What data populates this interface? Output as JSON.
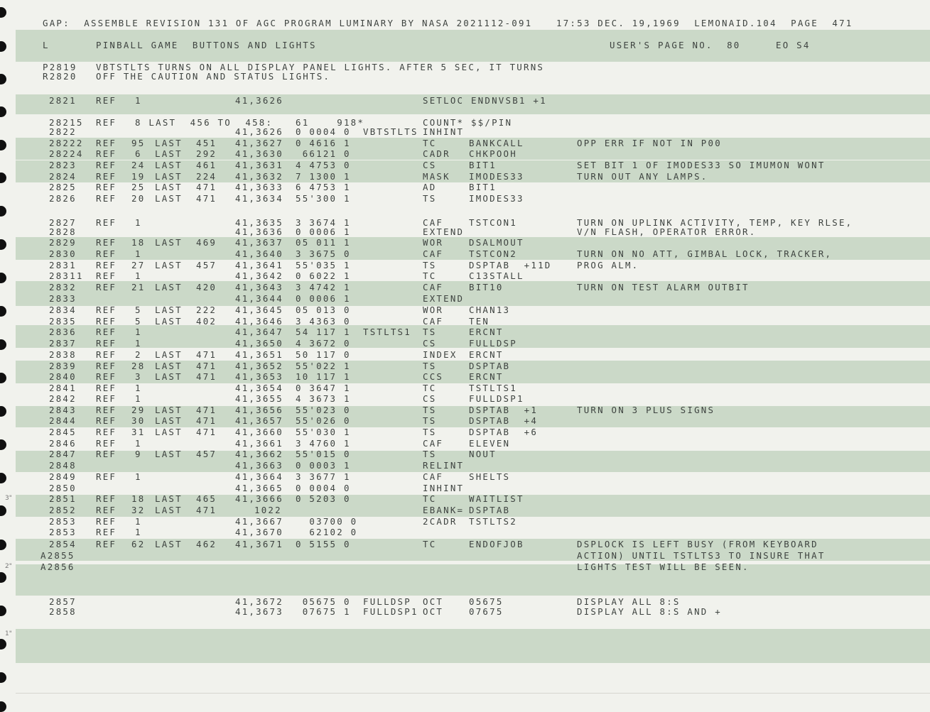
{
  "lines": [
    [
      26,
      60,
      "GAP:  ASSEMBLE REVISION 131 OF AGC PROGRAM LUMINARY BY NASA 2021112-091"
    ],
    [
      26,
      783,
      "17:53 DEC. 19,1969  LEMONAID.104  PAGE  471"
    ],
    [
      57,
      60,
      "L"
    ],
    [
      57,
      135,
      "PINBALL GAME  BUTTONS AND LIGHTS"
    ],
    [
      57,
      858,
      "USER'S PAGE NO.  80"
    ],
    [
      57,
      1092,
      "EO S4"
    ],
    [
      88,
      60,
      "P2819"
    ],
    [
      88,
      135,
      "VBTSTLTS TURNS ON ALL DISPLAY PANEL LIGHTS. AFTER 5 SEC, IT TURNS"
    ],
    [
      101,
      60,
      "R2820"
    ],
    [
      101,
      135,
      "OFF THE CAUTION AND STATUS LIGHTS."
    ],
    [
      135,
      69,
      "2821"
    ],
    [
      135,
      135,
      "REF"
    ],
    [
      135,
      190,
      "1"
    ],
    [
      135,
      331,
      "41,3626"
    ],
    [
      135,
      595,
      "SETLOC ENDNVSB1 +1"
    ],
    [
      166,
      69,
      "28215"
    ],
    [
      166,
      135,
      "REF"
    ],
    [
      166,
      190,
      "8 LAST  456 TO  458:"
    ],
    [
      166,
      416,
      "61    918*"
    ],
    [
      166,
      595,
      "COUNT* $$/PIN"
    ],
    [
      179,
      69,
      "2822"
    ],
    [
      179,
      331,
      "41,3626"
    ],
    [
      179,
      416,
      "0 0004 0"
    ],
    [
      179,
      511,
      "VBTSTLTS"
    ],
    [
      179,
      595,
      "INHINT"
    ],
    [
      195,
      69,
      "28222"
    ],
    [
      195,
      135,
      "REF"
    ],
    [
      195,
      185,
      "95"
    ],
    [
      195,
      218,
      "LAST"
    ],
    [
      195,
      276,
      "451"
    ],
    [
      195,
      331,
      "41,3627"
    ],
    [
      195,
      416,
      "0 4616 1"
    ],
    [
      195,
      595,
      "TC"
    ],
    [
      195,
      660,
      "BANKCALL"
    ],
    [
      195,
      812,
      "OPP ERR IF NOT IN P00"
    ],
    [
      210,
      69,
      "28224"
    ],
    [
      210,
      135,
      "REF"
    ],
    [
      210,
      190,
      "6"
    ],
    [
      210,
      218,
      "LAST"
    ],
    [
      210,
      276,
      "292"
    ],
    [
      210,
      331,
      "41,3630"
    ],
    [
      210,
      416,
      " 66121 0"
    ],
    [
      210,
      595,
      "CADR"
    ],
    [
      210,
      660,
      "CHKPOOH"
    ],
    [
      226,
      69,
      "2823"
    ],
    [
      226,
      135,
      "REF"
    ],
    [
      226,
      185,
      "24"
    ],
    [
      226,
      218,
      "LAST"
    ],
    [
      226,
      276,
      "461"
    ],
    [
      226,
      331,
      "41,3631"
    ],
    [
      226,
      416,
      "4 4753 0"
    ],
    [
      226,
      595,
      "CS"
    ],
    [
      226,
      660,
      "BIT1"
    ],
    [
      226,
      812,
      "SET BIT 1 OF IMODES33 SO IMUMON WONT"
    ],
    [
      242,
      69,
      "2824"
    ],
    [
      242,
      135,
      "REF"
    ],
    [
      242,
      185,
      "19"
    ],
    [
      242,
      218,
      "LAST"
    ],
    [
      242,
      276,
      "224"
    ],
    [
      242,
      331,
      "41,3632"
    ],
    [
      242,
      416,
      "7 1300 1"
    ],
    [
      242,
      595,
      "MASK"
    ],
    [
      242,
      660,
      "IMODES33"
    ],
    [
      242,
      812,
      "TURN OUT ANY LAMPS."
    ],
    [
      257,
      69,
      "2825"
    ],
    [
      257,
      135,
      "REF"
    ],
    [
      257,
      185,
      "25"
    ],
    [
      257,
      218,
      "LAST"
    ],
    [
      257,
      276,
      "471"
    ],
    [
      257,
      331,
      "41,3633"
    ],
    [
      257,
      416,
      "6 4753 1"
    ],
    [
      257,
      595,
      "AD"
    ],
    [
      257,
      660,
      "BIT1"
    ],
    [
      273,
      69,
      "2826"
    ],
    [
      273,
      135,
      "REF"
    ],
    [
      273,
      185,
      "20"
    ],
    [
      273,
      218,
      "LAST"
    ],
    [
      273,
      276,
      "471"
    ],
    [
      273,
      331,
      "41,3634"
    ],
    [
      273,
      416,
      "55'300 1"
    ],
    [
      273,
      595,
      "TS"
    ],
    [
      273,
      660,
      "IMODES33"
    ],
    [
      307,
      69,
      "2827"
    ],
    [
      307,
      135,
      "REF"
    ],
    [
      307,
      190,
      "1"
    ],
    [
      307,
      331,
      "41,3635"
    ],
    [
      307,
      416,
      "3 3674 1"
    ],
    [
      307,
      595,
      "CAF"
    ],
    [
      307,
      660,
      "TSTCON1"
    ],
    [
      307,
      812,
      "TURN ON UPLINK ACTIVITY, TEMP, KEY RLSE,"
    ],
    [
      320,
      69,
      "2828"
    ],
    [
      320,
      331,
      "41,3636"
    ],
    [
      320,
      416,
      "0 0006 1"
    ],
    [
      320,
      595,
      "EXTEND"
    ],
    [
      320,
      812,
      "V/N FLASH, OPERATOR ERROR."
    ],
    [
      335,
      69,
      "2829"
    ],
    [
      335,
      135,
      "REF"
    ],
    [
      335,
      185,
      "18"
    ],
    [
      335,
      218,
      "LAST"
    ],
    [
      335,
      276,
      "469"
    ],
    [
      335,
      331,
      "41,3637"
    ],
    [
      335,
      416,
      "05 011 1"
    ],
    [
      335,
      595,
      "WOR"
    ],
    [
      335,
      660,
      "DSALMOUT"
    ],
    [
      351,
      69,
      "2830"
    ],
    [
      351,
      135,
      "REF"
    ],
    [
      351,
      190,
      "1"
    ],
    [
      351,
      331,
      "41,3640"
    ],
    [
      351,
      416,
      "3 3675 0"
    ],
    [
      351,
      595,
      "CAF"
    ],
    [
      351,
      660,
      "TSTCON2"
    ],
    [
      351,
      812,
      "TURN ON NO ATT, GIMBAL LOCK, TRACKER,"
    ],
    [
      367,
      69,
      "2831"
    ],
    [
      367,
      135,
      "REF"
    ],
    [
      367,
      185,
      "27"
    ],
    [
      367,
      218,
      "LAST"
    ],
    [
      367,
      276,
      "457"
    ],
    [
      367,
      331,
      "41,3641"
    ],
    [
      367,
      416,
      "55'035 1"
    ],
    [
      367,
      595,
      "TS"
    ],
    [
      367,
      660,
      "DSPTAB  +11D"
    ],
    [
      367,
      812,
      "PROG ALM."
    ],
    [
      382,
      69,
      "28311"
    ],
    [
      382,
      135,
      "REF"
    ],
    [
      382,
      190,
      "1"
    ],
    [
      382,
      331,
      "41,3642"
    ],
    [
      382,
      416,
      "0 6022 1"
    ],
    [
      382,
      595,
      "TC"
    ],
    [
      382,
      660,
      "C13STALL"
    ],
    [
      398,
      69,
      "2832"
    ],
    [
      398,
      135,
      "REF"
    ],
    [
      398,
      185,
      "21"
    ],
    [
      398,
      218,
      "LAST"
    ],
    [
      398,
      276,
      "420"
    ],
    [
      398,
      331,
      "41,3643"
    ],
    [
      398,
      416,
      "3 4742 1"
    ],
    [
      398,
      595,
      "CAF"
    ],
    [
      398,
      660,
      "BIT10"
    ],
    [
      398,
      812,
      "TURN ON TEST ALARM OUTBIT"
    ],
    [
      414,
      69,
      "2833"
    ],
    [
      414,
      331,
      "41,3644"
    ],
    [
      414,
      416,
      "0 0006 1"
    ],
    [
      414,
      595,
      "EXTEND"
    ],
    [
      430,
      69,
      "2834"
    ],
    [
      430,
      135,
      "REF"
    ],
    [
      430,
      190,
      "5"
    ],
    [
      430,
      218,
      "LAST"
    ],
    [
      430,
      276,
      "222"
    ],
    [
      430,
      331,
      "41,3645"
    ],
    [
      430,
      416,
      "05 013 0"
    ],
    [
      430,
      595,
      "WOR"
    ],
    [
      430,
      660,
      "CHAN13"
    ],
    [
      446,
      69,
      "2835"
    ],
    [
      446,
      135,
      "REF"
    ],
    [
      446,
      190,
      "5"
    ],
    [
      446,
      218,
      "LAST"
    ],
    [
      446,
      276,
      "402"
    ],
    [
      446,
      331,
      "41,3646"
    ],
    [
      446,
      416,
      "3 4363 0"
    ],
    [
      446,
      595,
      "CAF"
    ],
    [
      446,
      660,
      "TEN"
    ],
    [
      461,
      69,
      "2836"
    ],
    [
      461,
      135,
      "REF"
    ],
    [
      461,
      190,
      "1"
    ],
    [
      461,
      331,
      "41,3647"
    ],
    [
      461,
      416,
      "54 117 1"
    ],
    [
      461,
      511,
      "TSTLTS1"
    ],
    [
      461,
      595,
      "TS"
    ],
    [
      461,
      660,
      "ERCNT"
    ],
    [
      477,
      69,
      "2837"
    ],
    [
      477,
      135,
      "REF"
    ],
    [
      477,
      190,
      "1"
    ],
    [
      477,
      331,
      "41,3650"
    ],
    [
      477,
      416,
      "4 3672 0"
    ],
    [
      477,
      595,
      "CS"
    ],
    [
      477,
      660,
      "FULLDSP"
    ],
    [
      493,
      69,
      "2838"
    ],
    [
      493,
      135,
      "REF"
    ],
    [
      493,
      190,
      "2"
    ],
    [
      493,
      218,
      "LAST"
    ],
    [
      493,
      276,
      "471"
    ],
    [
      493,
      331,
      "41,3651"
    ],
    [
      493,
      416,
      "50 117 0"
    ],
    [
      493,
      595,
      "INDEX"
    ],
    [
      493,
      660,
      "ERCNT"
    ],
    [
      509,
      69,
      "2839"
    ],
    [
      509,
      135,
      "REF"
    ],
    [
      509,
      185,
      "28"
    ],
    [
      509,
      218,
      "LAST"
    ],
    [
      509,
      276,
      "471"
    ],
    [
      509,
      331,
      "41,3652"
    ],
    [
      509,
      416,
      "55'022 1"
    ],
    [
      509,
      595,
      "TS"
    ],
    [
      509,
      660,
      "DSPTAB"
    ],
    [
      524,
      69,
      "2840"
    ],
    [
      524,
      135,
      "REF"
    ],
    [
      524,
      190,
      "3"
    ],
    [
      524,
      218,
      "LAST"
    ],
    [
      524,
      276,
      "471"
    ],
    [
      524,
      331,
      "41,3653"
    ],
    [
      524,
      416,
      "10 117 1"
    ],
    [
      524,
      595,
      "CCS"
    ],
    [
      524,
      660,
      "ERCNT"
    ],
    [
      540,
      69,
      "2841"
    ],
    [
      540,
      135,
      "REF"
    ],
    [
      540,
      190,
      "1"
    ],
    [
      540,
      331,
      "41,3654"
    ],
    [
      540,
      416,
      "0 3647 1"
    ],
    [
      540,
      595,
      "TC"
    ],
    [
      540,
      660,
      "TSTLTS1"
    ],
    [
      555,
      69,
      "2842"
    ],
    [
      555,
      135,
      "REF"
    ],
    [
      555,
      190,
      "1"
    ],
    [
      555,
      331,
      "41,3655"
    ],
    [
      555,
      416,
      "4 3673 1"
    ],
    [
      555,
      595,
      "CS"
    ],
    [
      555,
      660,
      "FULLDSP1"
    ],
    [
      571,
      69,
      "2843"
    ],
    [
      571,
      135,
      "REF"
    ],
    [
      571,
      185,
      "29"
    ],
    [
      571,
      218,
      "LAST"
    ],
    [
      571,
      276,
      "471"
    ],
    [
      571,
      331,
      "41,3656"
    ],
    [
      571,
      416,
      "55'023 0"
    ],
    [
      571,
      595,
      "TS"
    ],
    [
      571,
      660,
      "DSPTAB  +1"
    ],
    [
      571,
      812,
      "TURN ON 3 PLUS SIGNS"
    ],
    [
      586,
      69,
      "2844"
    ],
    [
      586,
      135,
      "REF"
    ],
    [
      586,
      185,
      "30"
    ],
    [
      586,
      218,
      "LAST"
    ],
    [
      586,
      276,
      "471"
    ],
    [
      586,
      331,
      "41,3657"
    ],
    [
      586,
      416,
      "55'026 0"
    ],
    [
      586,
      595,
      "TS"
    ],
    [
      586,
      660,
      "DSPTAB  +4"
    ],
    [
      602,
      69,
      "2845"
    ],
    [
      602,
      135,
      "REF"
    ],
    [
      602,
      185,
      "31"
    ],
    [
      602,
      218,
      "LAST"
    ],
    [
      602,
      276,
      "471"
    ],
    [
      602,
      331,
      "41,3660"
    ],
    [
      602,
      416,
      "55'030 1"
    ],
    [
      602,
      595,
      "TS"
    ],
    [
      602,
      660,
      "DSPTAB  +6"
    ],
    [
      618,
      69,
      "2846"
    ],
    [
      618,
      135,
      "REF"
    ],
    [
      618,
      190,
      "1"
    ],
    [
      618,
      331,
      "41,3661"
    ],
    [
      618,
      416,
      "3 4760 1"
    ],
    [
      618,
      595,
      "CAF"
    ],
    [
      618,
      660,
      "ELEVEN"
    ],
    [
      633,
      69,
      "2847"
    ],
    [
      633,
      135,
      "REF"
    ],
    [
      633,
      190,
      "9"
    ],
    [
      633,
      218,
      "LAST"
    ],
    [
      633,
      276,
      "457"
    ],
    [
      633,
      331,
      "41,3662"
    ],
    [
      633,
      416,
      "55'015 0"
    ],
    [
      633,
      595,
      "TS"
    ],
    [
      633,
      660,
      "NOUT"
    ],
    [
      649,
      69,
      "2848"
    ],
    [
      649,
      331,
      "41,3663"
    ],
    [
      649,
      416,
      "0 0003 1"
    ],
    [
      649,
      595,
      "RELINT"
    ],
    [
      665,
      69,
      "2849"
    ],
    [
      665,
      135,
      "REF"
    ],
    [
      665,
      190,
      "1"
    ],
    [
      665,
      331,
      "41,3664"
    ],
    [
      665,
      416,
      "3 3677 1"
    ],
    [
      665,
      595,
      "CAF"
    ],
    [
      665,
      660,
      "SHELTS"
    ],
    [
      681,
      69,
      "2850"
    ],
    [
      681,
      331,
      "41,3665"
    ],
    [
      681,
      416,
      "0 0004 0"
    ],
    [
      681,
      595,
      "INHINT"
    ],
    [
      696,
      69,
      "2851"
    ],
    [
      696,
      135,
      "REF"
    ],
    [
      696,
      185,
      "18"
    ],
    [
      696,
      218,
      "LAST"
    ],
    [
      696,
      276,
      "465"
    ],
    [
      696,
      331,
      "41,3666"
    ],
    [
      696,
      416,
      "0 5203 0"
    ],
    [
      696,
      595,
      "TC"
    ],
    [
      696,
      660,
      "WAITLIST"
    ],
    [
      712,
      69,
      "2852"
    ],
    [
      712,
      135,
      "REF"
    ],
    [
      712,
      185,
      "32"
    ],
    [
      712,
      218,
      "LAST"
    ],
    [
      712,
      276,
      "471"
    ],
    [
      712,
      358,
      "1022"
    ],
    [
      712,
      595,
      "EBANK="
    ],
    [
      712,
      660,
      "DSPTAB"
    ],
    [
      728,
      69,
      "2853"
    ],
    [
      728,
      135,
      "REF"
    ],
    [
      728,
      190,
      "1"
    ],
    [
      728,
      331,
      "41,3667"
    ],
    [
      728,
      416,
      "  03700 0"
    ],
    [
      728,
      595,
      "2CADR"
    ],
    [
      728,
      660,
      "TSTLTS2"
    ],
    [
      743,
      69,
      "2853"
    ],
    [
      743,
      135,
      "REF"
    ],
    [
      743,
      190,
      "1"
    ],
    [
      743,
      331,
      "41,3670"
    ],
    [
      743,
      416,
      "  62102 0"
    ],
    [
      760,
      69,
      "2854"
    ],
    [
      760,
      135,
      "REF"
    ],
    [
      760,
      185,
      "62"
    ],
    [
      760,
      218,
      "LAST"
    ],
    [
      760,
      276,
      "462"
    ],
    [
      760,
      331,
      "41,3671"
    ],
    [
      760,
      416,
      "0 5155 0"
    ],
    [
      760,
      595,
      "TC"
    ],
    [
      760,
      660,
      "ENDOFJOB"
    ],
    [
      760,
      812,
      "DSPLOCK IS LEFT BUSY (FROM KEYBOARD"
    ],
    [
      776,
      57,
      "A2855"
    ],
    [
      776,
      812,
      "ACTION) UNTIL TSTLTS3 TO INSURE THAT"
    ],
    [
      792,
      57,
      "A2856"
    ],
    [
      792,
      812,
      "LIGHTS TEST WILL BE SEEN."
    ],
    [
      841,
      69,
      "2857"
    ],
    [
      841,
      331,
      "41,3672"
    ],
    [
      841,
      416,
      " 05675 0"
    ],
    [
      841,
      511,
      "FULLDSP"
    ],
    [
      841,
      595,
      "OCT"
    ],
    [
      841,
      660,
      "05675"
    ],
    [
      841,
      812,
      "DISPLAY ALL 8:S"
    ],
    [
      855,
      69,
      "2858"
    ],
    [
      855,
      331,
      "41,3673"
    ],
    [
      855,
      416,
      " 07675 1"
    ],
    [
      855,
      511,
      "FULLDSP1"
    ],
    [
      855,
      595,
      "OCT"
    ],
    [
      855,
      660,
      "07675"
    ],
    [
      855,
      812,
      "DISPLAY ALL 8:S AND +"
    ]
  ],
  "margin_ticks": [
    [
      697,
      "3\""
    ],
    [
      793,
      "2\""
    ],
    [
      888,
      "1\""
    ]
  ]
}
